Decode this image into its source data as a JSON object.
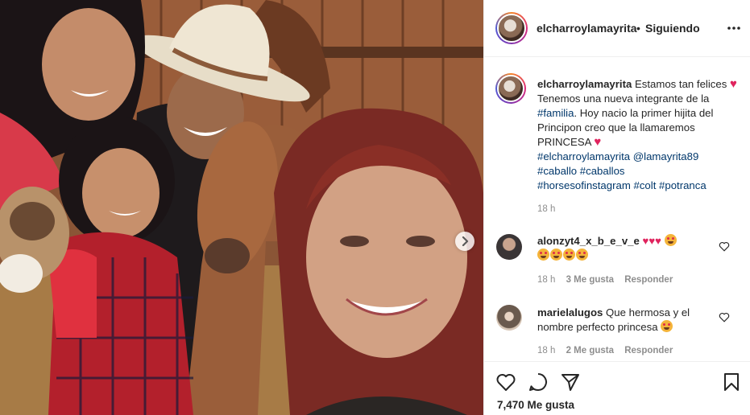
{
  "header": {
    "username": "elcharroylamayrita",
    "separator": "•",
    "follow_status": "Siguiendo",
    "more_icon": "more-horizontal-icon"
  },
  "caption": {
    "username": "elcharroylamayrita",
    "text_1": "Estamos tan felices",
    "text_2": "Tenemos una nueva integrante de la",
    "tag_familia": "#familia",
    "text_3": ". Hoy nacio la primer hijita del Principon creo que la llamaremos PRINCESA",
    "tags": [
      "#elcharroylamayrita",
      "@lamayrita89",
      "#caballo",
      "#caballos",
      "#horsesofinstagram",
      "#colt",
      "#potranca"
    ],
    "time": "18 h"
  },
  "comments": [
    {
      "username": "alonzyt4_x_b_e_v_e",
      "time": "18 h",
      "likes": "3 Me gusta",
      "reply": "Responder"
    },
    {
      "username": "marielalugos",
      "text": "Que hermosa y el nombre perfecto princesa",
      "time": "18 h",
      "likes": "2 Me gusta",
      "reply": "Responder"
    }
  ],
  "actions": {
    "like_icon": "heart-icon",
    "comment_icon": "comment-icon",
    "share_icon": "share-icon",
    "save_icon": "bookmark-icon",
    "likes_count": "7,470 Me gusta"
  },
  "colors": {
    "link": "#00376b",
    "muted": "#8e8e8e",
    "heart": "#e0245e"
  }
}
